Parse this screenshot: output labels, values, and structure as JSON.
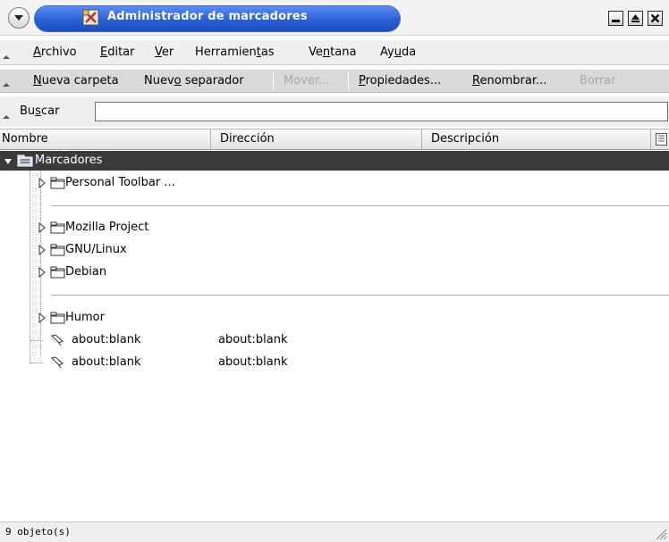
{
  "window": {
    "title": "Administrador de marcadores",
    "icons": {
      "menu": "window-menu-icon",
      "app": "bookmarks-app-icon",
      "minimize": "minimize-icon",
      "maximize": "maximize-icon",
      "close": "close-icon"
    }
  },
  "menubar": {
    "items": [
      {
        "pre": "",
        "key": "A",
        "post": "rchivo"
      },
      {
        "pre": "",
        "key": "E",
        "post": "ditar"
      },
      {
        "pre": "",
        "key": "V",
        "post": "er"
      },
      {
        "pre": "Herramien",
        "key": "t",
        "post": "as"
      },
      {
        "pre": "Ve",
        "key": "n",
        "post": "tana"
      },
      {
        "pre": "Ay",
        "key": "u",
        "post": "da"
      }
    ]
  },
  "toolbar": {
    "new_folder": {
      "pre": "",
      "key": "N",
      "post": "ueva carpeta"
    },
    "new_separator": {
      "pre": "Nuev",
      "key": "o",
      "post": " separador"
    },
    "move": "Mover...",
    "properties": {
      "pre": "",
      "key": "P",
      "post": "ropiedades..."
    },
    "rename": {
      "pre": "",
      "key": "R",
      "post": "enombrar..."
    },
    "delete": "Borrar"
  },
  "search": {
    "pre": "Bu",
    "key": "s",
    "post": "car",
    "value": ""
  },
  "columns": [
    "Nombre",
    "Dirección",
    "Descripción"
  ],
  "tree": {
    "root": "Marcadores",
    "items": [
      {
        "type": "folder",
        "name": "Personal Toolbar ..."
      },
      {
        "type": "separator"
      },
      {
        "type": "folder",
        "name": "Mozilla Project"
      },
      {
        "type": "folder",
        "name": "GNU/Linux"
      },
      {
        "type": "folder",
        "name": "Debian"
      },
      {
        "type": "separator"
      },
      {
        "type": "folder",
        "name": "Humor"
      },
      {
        "type": "bookmark",
        "name": "about:blank",
        "address": "about:blank"
      },
      {
        "type": "bookmark",
        "name": "about:blank",
        "address": "about:blank"
      }
    ]
  },
  "status": {
    "text": "9 objeto(s)"
  },
  "colors": {
    "title_blue": "#2a5ed4",
    "root_row": "#3b3b3b",
    "toolbar": "#d9d9d9"
  }
}
